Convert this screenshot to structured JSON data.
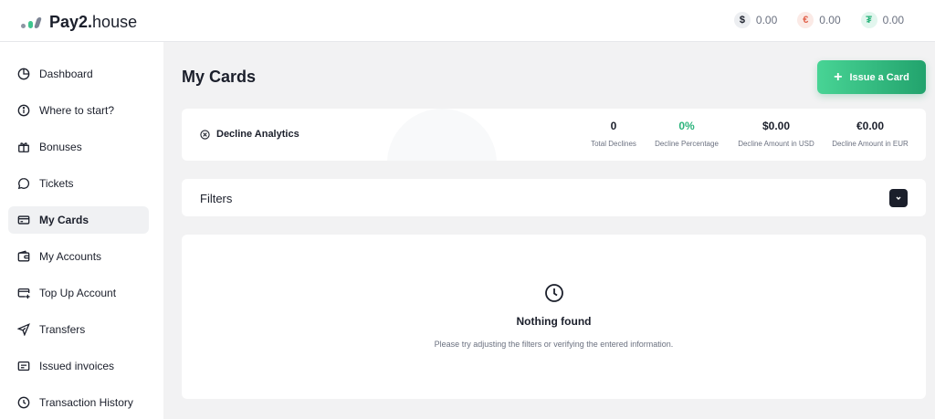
{
  "brand": {
    "name_bold": "Pay2.",
    "name_regular": "house"
  },
  "balances": [
    {
      "symbol": "$",
      "amount": "0.00",
      "icon": "dollar-icon",
      "color": "#1b1f2b"
    },
    {
      "symbol": "€",
      "amount": "0.00",
      "icon": "euro-icon",
      "color": "#e2654f"
    },
    {
      "symbol": "₮",
      "amount": "0.00",
      "icon": "tether-icon",
      "color": "#2bb37b"
    }
  ],
  "sidebar": {
    "items": [
      {
        "label": "Dashboard",
        "icon": "pie-chart-icon"
      },
      {
        "label": "Where to start?",
        "icon": "info-icon"
      },
      {
        "label": "Bonuses",
        "icon": "gift-icon"
      },
      {
        "label": "Tickets",
        "icon": "chat-icon"
      },
      {
        "label": "My Cards",
        "icon": "credit-card-icon",
        "active": true
      },
      {
        "label": "My Accounts",
        "icon": "wallet-icon"
      },
      {
        "label": "Top Up Account",
        "icon": "card-plus-icon"
      },
      {
        "label": "Transfers",
        "icon": "send-icon"
      },
      {
        "label": "Issued invoices",
        "icon": "invoice-icon"
      },
      {
        "label": "Transaction History",
        "icon": "clock-icon"
      }
    ]
  },
  "main": {
    "title": "My Cards",
    "issue_button": "Issue a Card",
    "analytics": {
      "title": "Decline Analytics",
      "stats": [
        {
          "value": "0",
          "label": "Total Declines"
        },
        {
          "value": "0%",
          "label": "Decline Percentage"
        },
        {
          "value": "$0.00",
          "label": "Decline Amount in USD"
        },
        {
          "value": "€0.00",
          "label": "Decline Amount in EUR"
        }
      ]
    },
    "filters": {
      "label": "Filters"
    },
    "empty": {
      "title": "Nothing found",
      "subtitle": "Please try adjusting the filters or verifying the entered information."
    }
  },
  "colors": {
    "accent": "#2bb37b",
    "dark": "#1b1f2b"
  }
}
